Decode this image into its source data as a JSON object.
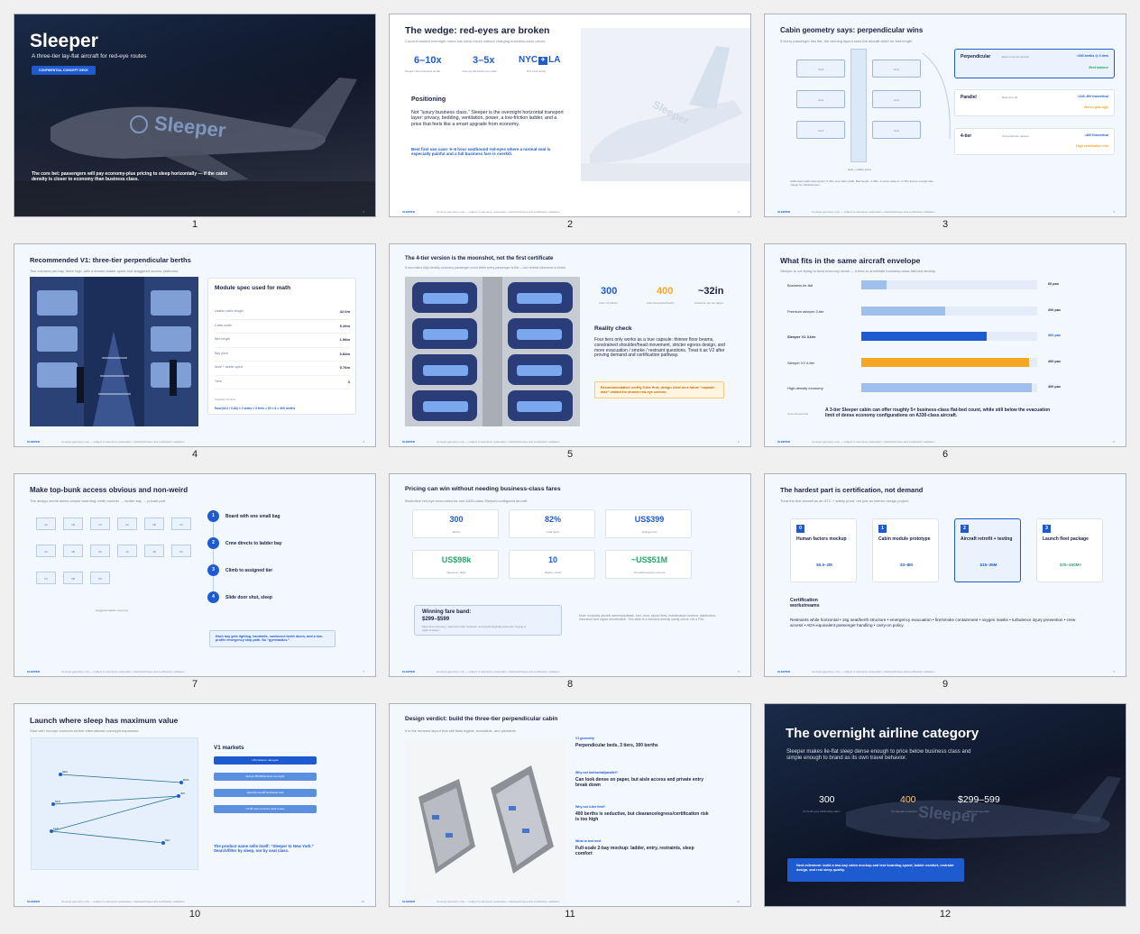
{
  "brand": "SLEEPER",
  "footer_text": "Concept geometry only — subject to structural, evacuation, crashworthiness and certification validation.",
  "slide_numbers": [
    "1",
    "2",
    "3",
    "4",
    "5",
    "6",
    "7",
    "8",
    "9",
    "10",
    "11",
    "12"
  ],
  "colors": {
    "accent": "#1f5bd0",
    "orange": "#f5a623",
    "dark": "#0e1628",
    "green": "#2aa56b"
  },
  "s1": {
    "title": "Sleeper",
    "subtitle": "A three-tier lay-flat aircraft for red-eye routes",
    "badge": "CONFIDENTIAL CONCEPT DECK",
    "livery": "Sleeper",
    "bet": "The core bet: passengers will pay economy-plus pricing to sleep horizontally — if the cabin density is closer to economy than business class."
  },
  "s2": {
    "title": "The wedge: red-eyes are broken",
    "sub": "Convert wasted overnight hours into sleep hours without charging business-class prices.",
    "stats": [
      {
        "v": "6–10x",
        "l": "cheaper than business lie-flat"
      },
      {
        "v": "3–5x",
        "l": "more lay-flat berths per cabin"
      },
      {
        "v": "NYC",
        "v2": "LA",
        "l": "first route family"
      }
    ],
    "pos_h": "Positioning",
    "pos_t": "Not “luxury business class.” Sleeper is the overnight horizontal transport layer: privacy, bedding, ventilation, power, a low-friction ladder, and a price that feels like a smart upgrade from economy.",
    "best": "Best first use case: 5–6 hour eastbound red-eyes where a normal seat is especially painful and a full business fare is overkill.",
    "livery": "Sleeper"
  },
  "s3": {
    "title": "Cabin geometry says: perpendicular wins",
    "sub": "If every passenger lies flat, the winning layout uses the aircraft width for bed length.",
    "bed": "bed",
    "aisle": "aisle + ladder spine",
    "note": "A330-class width assumption: 5.26m max cabin width. Bed length ~1.98m. A center aisle of ~0.76m leaves enough side margin for shell/structure.",
    "options": [
      {
        "n": "Perpendicular",
        "d": "Beds cross the aircraft",
        "v": "≈300 berths @ 3 tiers",
        "t": "Best balance"
      },
      {
        "n": "Parallel",
        "d": "Beds fore-aft",
        "v": "≈240–300 theoretical",
        "t": "Worse gets ugly"
      },
      {
        "n": "4-tier",
        "d": "Perpendicular capsule",
        "v": "≈400 theoretical",
        "t": "High certification risk"
      }
    ]
  },
  "s4": {
    "title": "Recommended V1: three-tier perpendicular berths",
    "sub": "Two columns per bay, three high, with a shared ladder spine and staggered access platforms.",
    "spec_h": "Module spec used for math",
    "rows": [
      {
        "k": "Usable cabin length",
        "v": "42.0m"
      },
      {
        "k": "Cabin width",
        "v": "5.26m"
      },
      {
        "k": "Bed length",
        "v": "1.98m"
      },
      {
        "k": "Bay pitch",
        "v": "0.84m"
      },
      {
        "k": "Aisle + ladder spine",
        "v": "0.76m"
      },
      {
        "k": "Tiers",
        "v": "3"
      }
    ],
    "cap_l": "Capacity formula",
    "cap": "floor(42.0 / 0.84) × 2 sides × 3 tiers = 50 × 6 = 300 berths"
  },
  "s5": {
    "title": "The 4-tier version is the moonshot, not the first certificate",
    "sub": "It can match high-density economy passenger count while every passenger is flat — but vertical clearance is brutal.",
    "stats": [
      {
        "v": "300",
        "l": "3-tier V1 berths"
      },
      {
        "v": "400",
        "l": "4-tier theoretical berths"
      },
      {
        "v": "~32in",
        "l": "clearance per tier target"
      }
    ],
    "rc_h": "Reality check",
    "rc_t": "Four tiers only works as a true capsule: thinner floor beams, constrained shoulder/head movement, stricter egress design, and more evacuation / smoke / restraint questions. Treat it as V2 after proving demand and certification pathway.",
    "rec": "Recommendation: certify 3-tier first; design 4-tier as a future “capsule max” variant for shorter red-eye sectors."
  },
  "s6": {
    "title": "What fits in the same aircraft envelope",
    "sub": "Sleeper is not trying to beat economy seats — it tries to annihilate business-class flat-bed density.",
    "bars": [
      {
        "n": "Business lie-flat",
        "v": 60,
        "l": "60 pax"
      },
      {
        "n": "Premium sleeper 2-tier",
        "v": 200,
        "l": "200 pax"
      },
      {
        "n": "Sleeper V1 3-tier",
        "v": 300,
        "l": "300 pax"
      },
      {
        "n": "Sleeper V2 4-tier",
        "v": 400,
        "l": "400 pax"
      },
      {
        "n": "High-density economy",
        "v": 406,
        "l": "406 pax"
      }
    ],
    "core_l": "Core investor line",
    "core": "A 3-tier Sleeper cabin can offer roughly 5× business-class flat-bed count, while still below the evacuation limit of dense economy configurations on A330-class aircraft."
  },
  "s7": {
    "title": "Make top-bunk access obvious and non-weird",
    "sub": "The design needs airline-simple boarding: berth number → ladder bay → private pod.",
    "cells": [
      "1A",
      "1B",
      "1C",
      "2A",
      "2B",
      "2C",
      "3A",
      "3B",
      "3C",
      "4A",
      "4B",
      "4C",
      "5A",
      "5B",
      "5C"
    ],
    "stagger": "staggered ladder every bay",
    "steps": [
      "Board with one small bag",
      "Crew directs to ladder bay",
      "Climb to assigned tier",
      "Slide door shut, sleep"
    ],
    "note": "Each bay gets lighting, handrails, numbered berth doors, and a low-profile emergency step path. No “gymnastics.”"
  },
  "s8": {
    "title": "Pricing can win without needing business-class fares",
    "sub": "Illustrative red-eye economics for one A330-class Sleeper-configured aircraft.",
    "kpis": [
      {
        "v": "300",
        "l": "Berths"
      },
      {
        "v": "82%",
        "l": "Load factor"
      },
      {
        "v": "US$399",
        "l": "Average fare"
      },
      {
        "v": "US$98k",
        "l": "Revenue / flight"
      },
      {
        "v": "10",
        "l": "Flights / week"
      },
      {
        "v": "~US$51M",
        "l": "Annualized gross revenue"
      }
    ],
    "band_h": "Winning fare band:",
    "band_v": "$299–$599",
    "band_t": "More than economy, much less than business, and psychologically priced as “buying a night of sleep.”",
    "note": "Note: excludes aircraft ownership/lease, fuel, crew, airport fees, maintenance reserve, distribution, insurance and capex amortization. This slide is a demand-density sanity check, not a P&L."
  },
  "s9": {
    "title": "The hardest part is certification, not demand",
    "sub": "Treat the first aircraft as an STC + safety proof, not just an interior design project.",
    "phases": [
      {
        "n": "0",
        "t": "Human factors mockup",
        "c": "$0.5–2M"
      },
      {
        "n": "1",
        "t": "Cabin module prototype",
        "c": "$3–8M"
      },
      {
        "n": "2",
        "t": "Aircraft retrofit + testing",
        "c": "$15–35M"
      },
      {
        "n": "3",
        "t": "Launch fleet package",
        "c": "$75–150M+"
      }
    ],
    "ws_h": "Certification workstreams",
    "ws": "Restraints while horizontal  •  16g seat/berth structure  •  emergency evacuation  •  fire/smoke containment  •  oxygen masks  •  turbulence injury prevention  •  crew access  •  ADA-equivalent passenger handling  •  carry-on policy"
  },
  "s10": {
    "title": "Launch where sleep has maximum value",
    "sub": "Start with red-eye corridors before international overnight expansion.",
    "cities": [
      "SEA",
      "SFO",
      "LAX",
      "BOS",
      "JFK",
      "MIA"
    ],
    "v1": "V1 markets",
    "markets": [
      "US transcon red-eyes",
      "Europe ⇄ Middle East overnight",
      "Japan/Korea ⇄ Southeast Asia",
      "US ⇄ Latin America night routes"
    ],
    "note": "The product name sells itself: “Sleeper to New York.” Search/filter by sleep, not by seat class."
  },
  "s11": {
    "title": "Design verdict: build the three-tier perpendicular cabin",
    "sub": "It is the densest layout that still feels legible, boardable, and pitchable.",
    "items": [
      {
        "k": "V1 geometry",
        "v": "Perpendicular beds, 3 tiers, 300 berths"
      },
      {
        "k": "Why not horizontal/parallel?",
        "v": "Can look dense on paper, but aisle access and private entry break down"
      },
      {
        "k": "Why not 4-tier first?",
        "v": "400 berths is seductive, but clearance/egress/certification risk is too high"
      },
      {
        "k": "What to test next",
        "v": "Full-scale 2-bay mockup: ladder, entry, restraints, sleep comfort"
      }
    ]
  },
  "s12": {
    "title": "The overnight airline category",
    "sub": "Sleeper makes lie-flat sleep dense enough to price below business class and simple enough to brand as its own travel behavior.",
    "stats": [
      {
        "v": "300",
        "l": "V1 berths per A330-class cabin"
      },
      {
        "v": "400",
        "l": "V2 capsule moonshot"
      },
      {
        "v": "$299–599",
        "l": "target red-eye fare"
      }
    ],
    "next": "Next milestone: build a two-bay cabin mockup and test boarding speed, ladder comfort, restraint design, and real sleep quality.",
    "livery": "Sleeper"
  }
}
